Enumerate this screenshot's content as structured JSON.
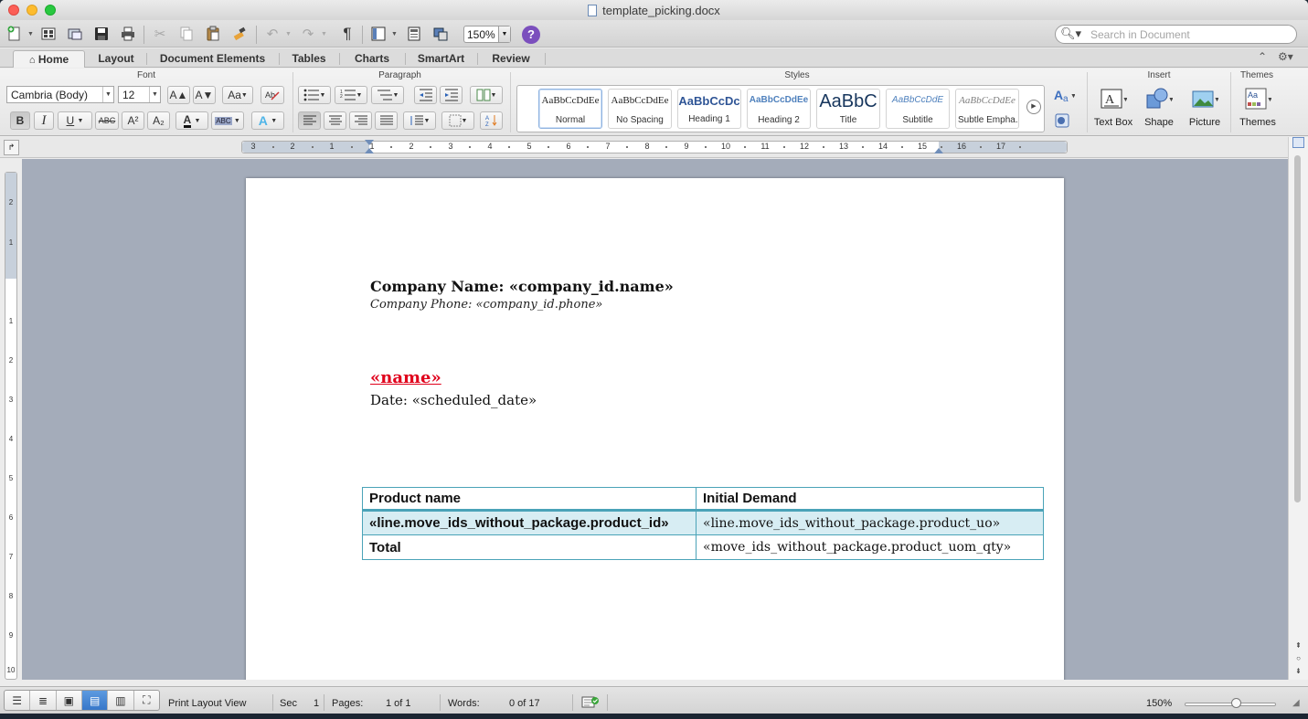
{
  "window": {
    "title": "template_picking.docx"
  },
  "toolbar": {
    "zoom": "150%",
    "search_placeholder": "Search in Document"
  },
  "tabs": [
    "Home",
    "Layout",
    "Document Elements",
    "Tables",
    "Charts",
    "SmartArt",
    "Review"
  ],
  "ribbon": {
    "groups": {
      "font": "Font",
      "paragraph": "Paragraph",
      "styles": "Styles",
      "insert": "Insert",
      "themes": "Themes"
    },
    "font_name": "Cambria (Body)",
    "font_size": "12",
    "styles": [
      {
        "sample": "AaBbCcDdEe",
        "name": "Normal"
      },
      {
        "sample": "AaBbCcDdEe",
        "name": "No Spacing"
      },
      {
        "sample": "AaBbCcDc",
        "name": "Heading 1"
      },
      {
        "sample": "AaBbCcDdEe",
        "name": "Heading 2"
      },
      {
        "sample": "AaBbC",
        "name": "Title"
      },
      {
        "sample": "AaBbCcDdE",
        "name": "Subtitle"
      },
      {
        "sample": "AaBbCcDdEe",
        "name": "Subtle Empha..."
      }
    ],
    "insert": {
      "text_box": "Text Box",
      "shape": "Shape",
      "picture": "Picture"
    },
    "themes_label": "Themes",
    "buttons": {
      "bold": "B",
      "italic": "I",
      "underline": "U",
      "strike": "ABC",
      "superscript": "A²",
      "subscript": "A₂",
      "grow": "A▲",
      "shrink": "A▼",
      "case": "Aa",
      "highlight": "ABC"
    }
  },
  "ruler": {
    "h_labels": [
      "3",
      "2",
      "1",
      "1",
      "2",
      "3",
      "4",
      "5",
      "6",
      "7",
      "8",
      "9",
      "10",
      "11",
      "12",
      "13",
      "14",
      "15",
      "16",
      "17"
    ],
    "v_labels": [
      "2",
      "1",
      "1",
      "2",
      "3",
      "4",
      "5",
      "6",
      "7",
      "8",
      "9",
      "10"
    ]
  },
  "document": {
    "company_line": "Company Name: «company_id.name»",
    "phone_line": "Company Phone: «company_id.phone»",
    "name_field": "«name»",
    "date_line": "Date: «scheduled_date»",
    "table": {
      "header": [
        "Product name",
        "Initial Demand"
      ],
      "rows": [
        [
          "«line.move_ids_without_package.product_id»",
          "«line.move_ids_without_package.product_uo»"
        ],
        [
          "Total",
          "«move_ids_without_package.product_uom_qty»"
        ]
      ]
    }
  },
  "status": {
    "view": "Print Layout View",
    "sec_label": "Sec",
    "sec_value": "1",
    "pages_label": "Pages:",
    "pages_value": "1 of 1",
    "words_label": "Words:",
    "words_value": "0 of 17",
    "zoom": "150%"
  },
  "icons": [
    "new-document-icon",
    "templates-icon",
    "open-icon",
    "save-icon",
    "print-icon",
    "cut-icon",
    "copy-icon",
    "paste-icon",
    "format-painter-icon",
    "undo-icon",
    "redo-icon",
    "pilcrow-icon",
    "sidebar-icon",
    "gallery-icon",
    "media-icon",
    "help-icon",
    "search-icon"
  ]
}
